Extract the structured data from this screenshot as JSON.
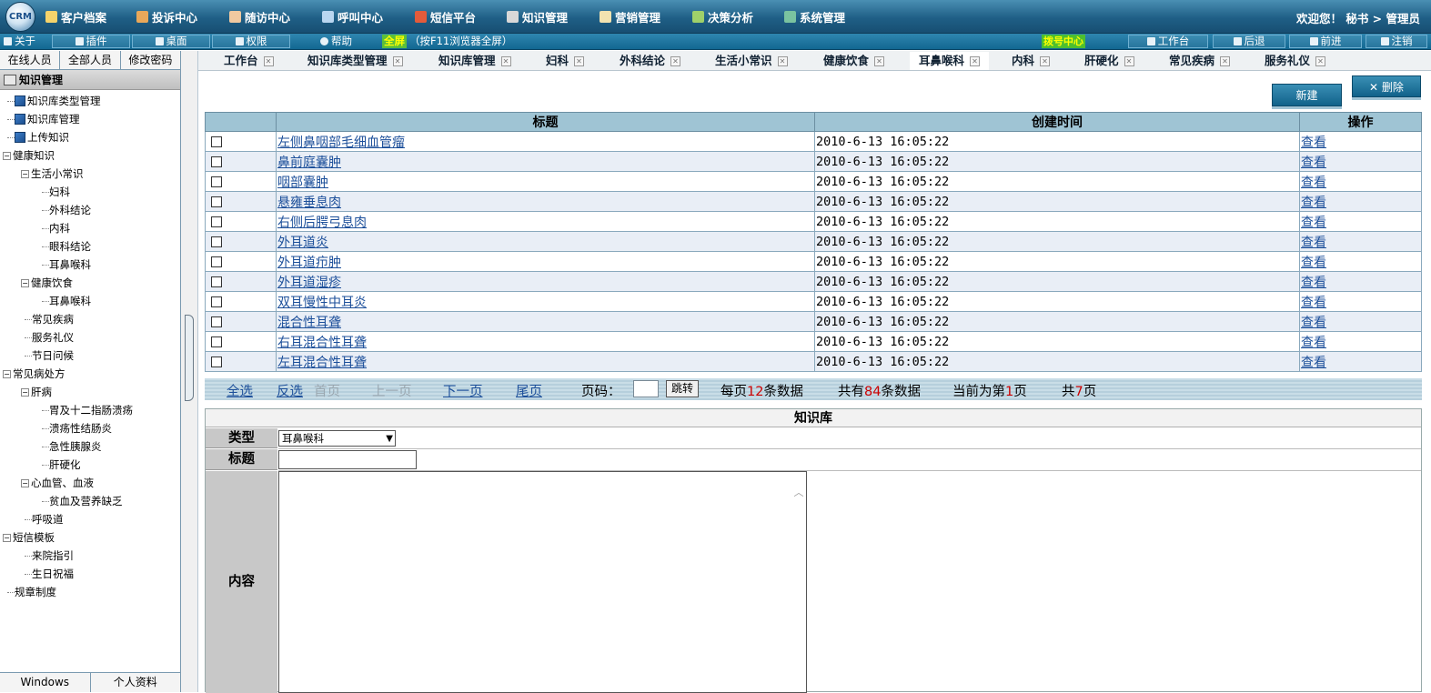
{
  "nav": {
    "logo": "CRM",
    "items": [
      "客户档案",
      "投诉中心",
      "随访中心",
      "呼叫中心",
      "短信平台",
      "知识管理",
      "营销管理",
      "决策分析",
      "系统管理"
    ],
    "welcome": "欢迎您！ 秘书 > 管理员"
  },
  "toolbar": {
    "about": "关于",
    "plugin": "插件",
    "desktop": "桌面",
    "permission": "权限",
    "help": "帮助",
    "full_label": "全屏",
    "full_hint": "（按F11浏览器全屏）",
    "dial_center": "拨号中心",
    "workbench": "工作台",
    "back": "后退",
    "forward": "前进",
    "logout": "注销"
  },
  "left": {
    "tabs": [
      "在线人员",
      "全部人员",
      "修改密码"
    ],
    "root": "知识管理",
    "tree": {
      "n0": "知识库类型管理",
      "n1": "知识库管理",
      "n2": "上传知识",
      "n3": "健康知识",
      "n4": "生活小常识",
      "n5": "妇科",
      "n6": "外科结论",
      "n7": "内科",
      "n8": "眼科结论",
      "n9": "耳鼻喉科",
      "n10": "健康饮食",
      "n11": "耳鼻喉科",
      "n12": "常见疾病",
      "n13": "服务礼仪",
      "n14": "节日问候",
      "n15": "常见病处方",
      "n16": "肝病",
      "n17": "胃及十二指肠溃疡",
      "n18": "溃疡性结肠炎",
      "n19": "急性胰腺炎",
      "n20": "肝硬化",
      "n21": "心血管、血液",
      "n22": "贫血及营养缺乏",
      "n23": "呼吸道",
      "n24": "短信模板",
      "n25": "来院指引",
      "n26": "生日祝福",
      "n27": "规章制度"
    },
    "bottom_tabs": [
      "Windows",
      "个人资料"
    ]
  },
  "tabs": [
    "工作台",
    "知识库类型管理",
    "知识库管理",
    "妇科",
    "外科结论",
    "生活小常识",
    "健康饮食",
    "耳鼻喉科",
    "内科",
    "肝硬化",
    "常见疾病",
    "服务礼仪"
  ],
  "buttons": {
    "new": "新建",
    "delete": "删除"
  },
  "grid": {
    "headers": {
      "title": "标题",
      "created": "创建时间",
      "action": "操作"
    },
    "rows": [
      {
        "title": "左侧鼻咽部毛细血管瘤",
        "created": "2010-6-13 16:05:22",
        "action": "查看"
      },
      {
        "title": "鼻前庭囊肿",
        "created": "2010-6-13 16:05:22",
        "action": "查看"
      },
      {
        "title": "咽部囊肿",
        "created": "2010-6-13 16:05:22",
        "action": "查看"
      },
      {
        "title": "悬雍垂息肉",
        "created": "2010-6-13 16:05:22",
        "action": "查看"
      },
      {
        "title": "右侧后腭弓息肉",
        "created": "2010-6-13 16:05:22",
        "action": "查看"
      },
      {
        "title": "外耳道炎",
        "created": "2010-6-13 16:05:22",
        "action": "查看"
      },
      {
        "title": "外耳道疖肿",
        "created": "2010-6-13 16:05:22",
        "action": "查看"
      },
      {
        "title": "外耳道湿疹",
        "created": "2010-6-13 16:05:22",
        "action": "查看"
      },
      {
        "title": "双耳慢性中耳炎",
        "created": "2010-6-13 16:05:22",
        "action": "查看"
      },
      {
        "title": "混合性耳聋",
        "created": "2010-6-13 16:05:22",
        "action": "查看"
      },
      {
        "title": "右耳混合性耳聋",
        "created": "2010-6-13 16:05:22",
        "action": "查看"
      },
      {
        "title": "左耳混合性耳聋",
        "created": "2010-6-13 16:05:22",
        "action": "查看"
      }
    ]
  },
  "pager": {
    "select_all": "全选",
    "invert": "反选",
    "first": "首页",
    "prev": "上一页",
    "next": "下一页",
    "last": "尾页",
    "page_label": "页码：",
    "jump": "跳转",
    "per_page_pre": "每页",
    "per_page": "12",
    "per_page_post": "条数据",
    "total_pre": "共有",
    "total": "84",
    "total_post": "条数据",
    "current_pre": "当前为第",
    "current": "1",
    "current_post": "页",
    "pages_pre": "共",
    "pages": "7",
    "pages_post": "页"
  },
  "form": {
    "title": "知识库",
    "type_label": "类型",
    "type_value": "耳鼻喉科",
    "title_label": "标题",
    "content_label": "内容"
  },
  "colors": {
    "nav_bg": "#1f5f86",
    "header_bg": "#9fc4d4",
    "row_alt": "#e9eef6",
    "link": "#1c4f9a",
    "accent_red": "#cc0000"
  }
}
